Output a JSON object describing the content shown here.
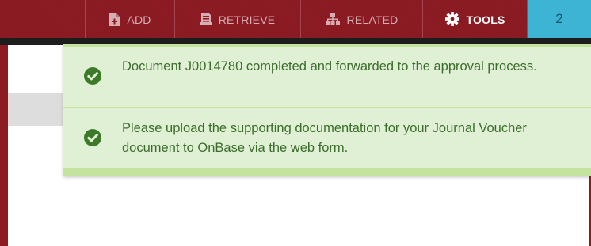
{
  "nav": {
    "items": [
      {
        "label": "ADD",
        "icon": "add-document-icon"
      },
      {
        "label": "RETRIEVE",
        "icon": "retrieve-document-icon"
      },
      {
        "label": "RELATED",
        "icon": "related-hierarchy-icon"
      },
      {
        "label": "TOOLS",
        "icon": "gear-icon"
      }
    ],
    "count": "2"
  },
  "notifications": [
    {
      "icon": "check-circle-icon",
      "message": "Document J0014780 completed and forwarded to the approval process."
    },
    {
      "icon": "check-circle-icon",
      "message": "Please upload the supporting documentation for your Journal Voucher document to OnBase via the web form."
    }
  ],
  "colors": {
    "header": "#8d1b23",
    "notification_background": "#dff0d4",
    "notification_text": "#3c6d2c",
    "success_icon": "#3c7a2a",
    "count_tab": "#3db4d4"
  }
}
